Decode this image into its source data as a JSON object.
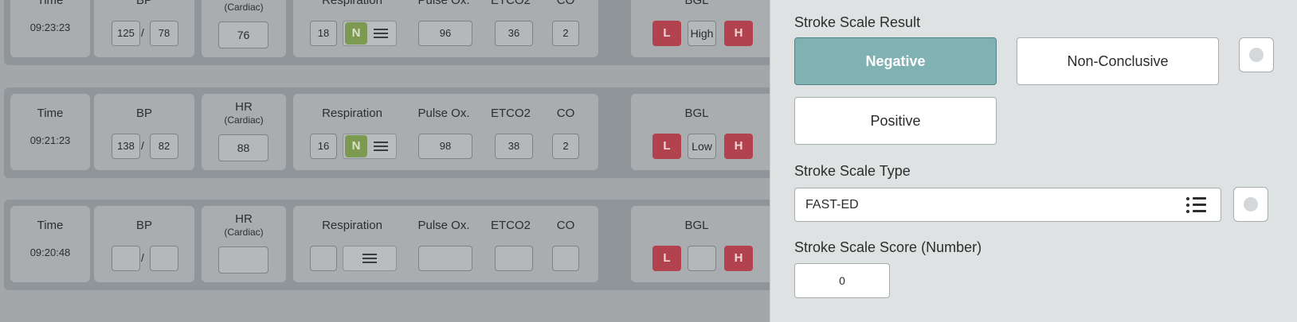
{
  "vitals": {
    "labels": {
      "time": "Time",
      "bp": "BP",
      "hr": "HR",
      "hr_sub": "(Cardiac)",
      "respiration": "Respiration",
      "pulse_ox": "Pulse Ox.",
      "etco2": "ETCO2",
      "co": "CO",
      "bgl": "BGL",
      "bp_separator": "/",
      "normal_badge": "N",
      "low_badge": "L",
      "high_badge": "H"
    },
    "rows": [
      {
        "time": "09:23:23",
        "bp_sys": "125",
        "bp_dia": "78",
        "hr": "76",
        "resp": "18",
        "resp_normal": true,
        "pulse_ox": "96",
        "etco2": "36",
        "co": "2",
        "bgl": "High"
      },
      {
        "time": "09:21:23",
        "bp_sys": "138",
        "bp_dia": "82",
        "hr": "88",
        "resp": "16",
        "resp_normal": true,
        "pulse_ox": "98",
        "etco2": "38",
        "co": "2",
        "bgl": "Low"
      },
      {
        "time": "09:20:48",
        "bp_sys": "",
        "bp_dia": "",
        "hr": "",
        "resp": "",
        "resp_normal": false,
        "pulse_ox": "",
        "etco2": "",
        "co": "",
        "bgl": ""
      }
    ]
  },
  "panel": {
    "stroke_result_label": "Stroke Scale Result",
    "options": {
      "negative": "Negative",
      "non_conclusive": "Non-Conclusive",
      "positive": "Positive"
    },
    "selected_option": "negative",
    "stroke_type_label": "Stroke Scale Type",
    "stroke_type_value": "FAST-ED",
    "stroke_score_label": "Stroke Scale Score (Number)",
    "stroke_score_value": "0"
  },
  "colors": {
    "selected": "#80b2b4",
    "low_high_badge": "#b2424e",
    "normal_badge": "#7c9a52"
  },
  "icons": {
    "list": "list-icon",
    "menu": "menu-icon",
    "radio": "circle-icon"
  }
}
